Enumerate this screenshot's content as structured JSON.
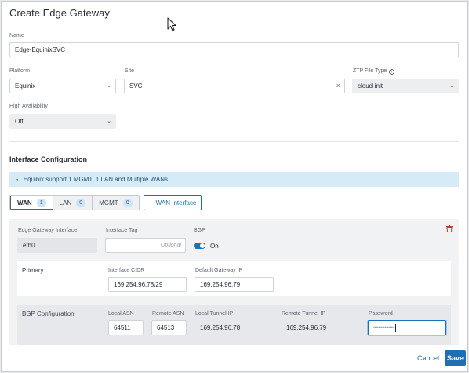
{
  "dialog": {
    "title": "Create Edge Gateway",
    "name": {
      "label": "Name",
      "value": "Edge-EquinixSVC"
    },
    "platform": {
      "label": "Platform",
      "value": "Equinix"
    },
    "site": {
      "label": "Site",
      "value": "SVC"
    },
    "ztp": {
      "label": "ZTP File Type",
      "value": "cloud-init"
    },
    "ha": {
      "label": "High Availability",
      "value": "Off"
    }
  },
  "interface_config": {
    "title": "Interface Configuration",
    "banner": "Equinix support 1 MGMT, 1 LAN and Multiple WANs",
    "tabs": [
      {
        "label": "WAN",
        "count": "1"
      },
      {
        "label": "LAN",
        "count": "0"
      },
      {
        "label": "MGMT",
        "count": "0"
      }
    ],
    "add_button": "WAN Interface",
    "interface": {
      "egi_label": "Edge Gateway Interface",
      "egi_value": "eth0",
      "tag_label": "Interface Tag",
      "tag_placeholder": "Optional",
      "bgp_label": "BGP",
      "bgp_state": "On"
    },
    "primary": {
      "label": "Primary",
      "cidr_label": "Interface CIDR",
      "cidr_value": "169.254.96.78/29",
      "gw_label": "Default Gateway IP",
      "gw_value": "169.254.96.79"
    },
    "bgp": {
      "label": "BGP Configuration",
      "local_asn_label": "Local ASN",
      "local_asn_value": "64511",
      "remote_asn_label": "Remote ASN",
      "remote_asn_value": "64513",
      "local_tunnel_label": "Local Tunnel IP",
      "local_tunnel_value": "169.254.96.78",
      "remote_tunnel_label": "Remote Tunnel IP",
      "remote_tunnel_value": "169.254.96.79",
      "password_label": "Password",
      "password_value": "•••••••••••••••••"
    }
  },
  "footer": {
    "cancel": "Cancel",
    "save": "Save"
  },
  "colors": {
    "accent": "#1f6fb5",
    "banner": "#d6ebf8",
    "delete": "#c0392b"
  }
}
